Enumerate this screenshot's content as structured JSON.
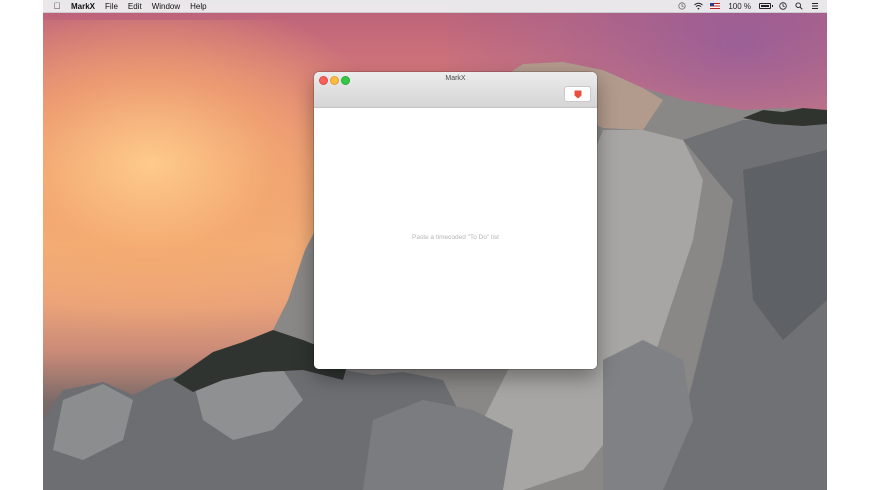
{
  "menubar": {
    "apple_icon": "apple-icon",
    "app_name": "MarkX",
    "menus": [
      "File",
      "Edit",
      "Window",
      "Help"
    ],
    "status": {
      "icons": [
        "time-machine-icon",
        "wifi-icon",
        "us-flag-icon",
        "battery-icon",
        "clock-icon",
        "spotlight-icon",
        "notification-center-icon"
      ],
      "battery_percent": "100 %"
    }
  },
  "window": {
    "title": "MarkX",
    "toolbar_button_icon": "red-marker-icon",
    "placeholder": "Paste a timecoded \"To Do\" list"
  },
  "colors": {
    "close": "#fc605c",
    "minimize": "#fdbc40",
    "maximize": "#34c84a",
    "marker": "#e8503f"
  }
}
